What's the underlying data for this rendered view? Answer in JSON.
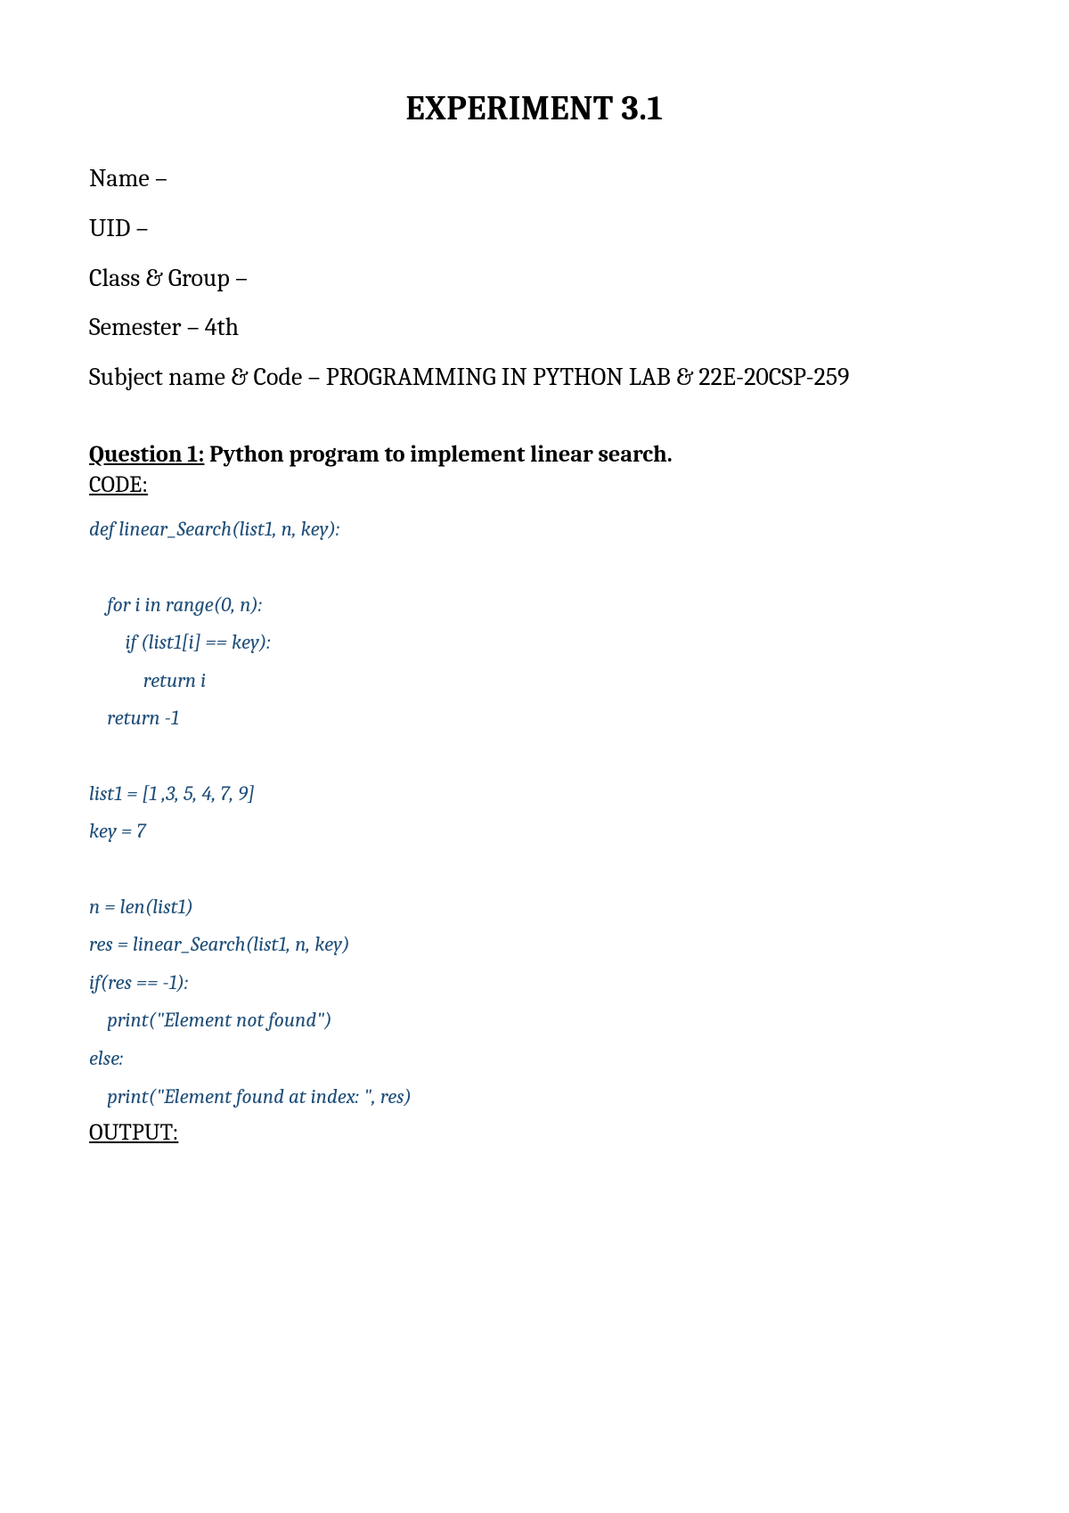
{
  "title": "EXPERIMENT 3.1",
  "info": {
    "name_label": "Name –",
    "uid_label": "UID –",
    "class_label": "Class & Group –",
    "semester_label": "Semester – 4th",
    "subject_label": "Subject name & Code – PROGRAMMING IN PYTHON LAB & 22E-20CSP-259"
  },
  "question": {
    "label": "Question 1:",
    "text": "  Python program to implement linear search.",
    "code_label": "CODE:",
    "output_label": "OUTPUT:"
  },
  "code": {
    "l1": "def linear_Search(list1, n, key):  ",
    "l2": "    for i in range(0, n):  ",
    "l3": "        if (list1[i] == key):  ",
    "l4": "            return i  ",
    "l5": "    return -1  ",
    "l6": "list1 = [1 ,3, 5, 4, 7, 9]  ",
    "l7": "key = 7  ",
    "l8": "n = len(list1)  ",
    "l9": "res = linear_Search(list1, n, key)  ",
    "l10": "if(res == -1):  ",
    "l11": "    print(\"Element not found\")  ",
    "l12": "else:  ",
    "l13": "    print(\"Element found at index: \", res)  "
  }
}
